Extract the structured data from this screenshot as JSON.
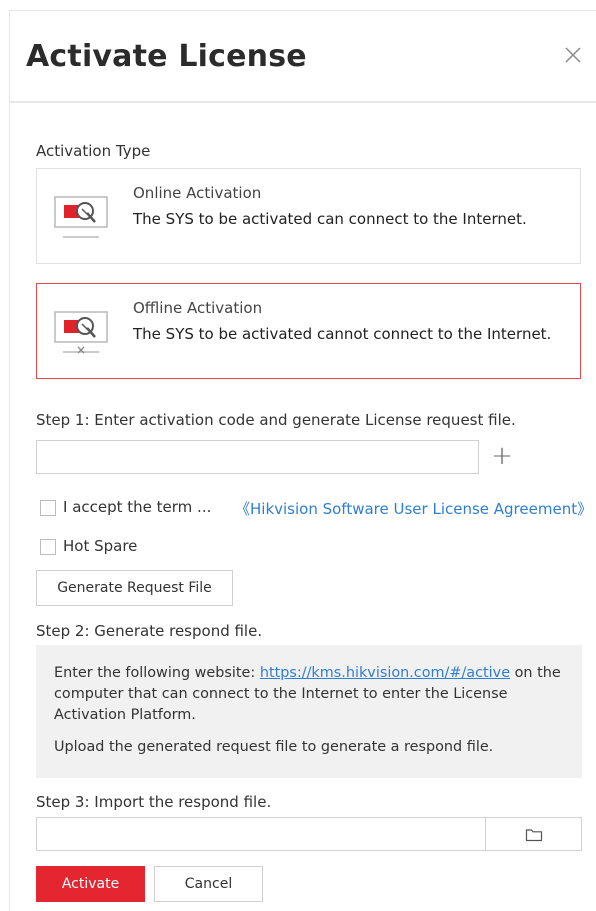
{
  "dialog": {
    "title": "Activate License"
  },
  "activation_type": {
    "label": "Activation Type",
    "options": [
      {
        "name": "Online Activation",
        "description": "The SYS to be activated can connect to the Internet.",
        "selected": false
      },
      {
        "name": "Offline Activation",
        "description": "The SYS to be activated cannot connect to the Internet.",
        "selected": true
      }
    ]
  },
  "step1": {
    "label": "Step 1: Enter activation code and generate License request file.",
    "code_input_value": "",
    "accept_label": "I accept the term ...",
    "agreement_link": "《Hikvision Software User License Agreement》",
    "hot_spare_label": "Hot Spare",
    "generate_button": "Generate Request File"
  },
  "step2": {
    "label": "Step 2: Generate respond file.",
    "text_before_link": "Enter the following website: ",
    "link": "https://kms.hikvision.com/#/active",
    "text_after_link": " on the computer that can connect to the Internet to enter the License Activation Platform.",
    "upload_text": "Upload the generated request file to generate a respond file."
  },
  "step3": {
    "label": "Step 3: Import the respond file.",
    "file_input_value": ""
  },
  "footer": {
    "activate_button": "Activate",
    "cancel_button": "Cancel"
  },
  "colors": {
    "accent_red": "#e3262f",
    "selected_border": "#e2484e",
    "link_blue": "#2f7fd0",
    "info_background": "#f1f1f1"
  },
  "icons": [
    "close-icon",
    "online-activation-icon",
    "offline-activation-icon",
    "plus-icon",
    "folder-icon"
  ]
}
